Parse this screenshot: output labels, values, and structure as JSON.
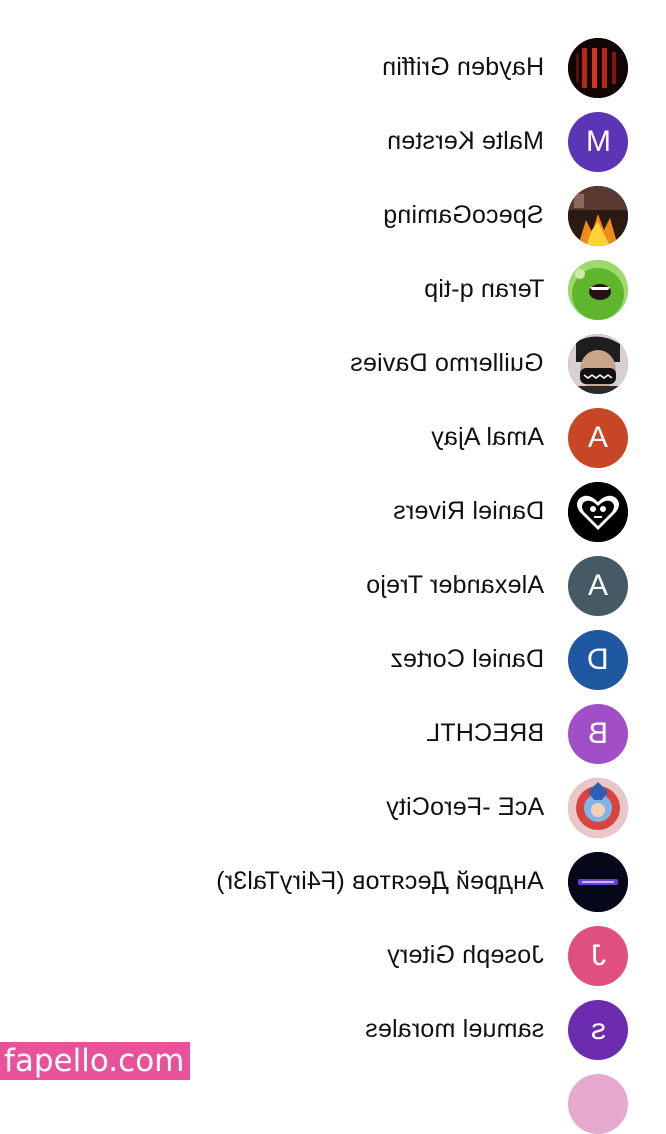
{
  "users": [
    {
      "name": "Hayden Griffin",
      "avatar_type": "image",
      "avatar_icon": "dark-red-game-art-avatar",
      "avatar_color": "#1a0a08"
    },
    {
      "name": "Malte Kersten",
      "avatar_type": "initial",
      "initial": "M",
      "avatar_color": "#5b35b5"
    },
    {
      "name": "SpecoGaming",
      "avatar_type": "image",
      "avatar_icon": "fire-scene-avatar",
      "avatar_color": "#3a1f14"
    },
    {
      "name": "Teran q-tip",
      "avatar_type": "image",
      "avatar_icon": "green-monster-avatar",
      "avatar_color": "#7bc43e"
    },
    {
      "name": "Guillermo Davies",
      "avatar_type": "image",
      "avatar_icon": "masked-person-avatar",
      "avatar_color": "#3c3c3c"
    },
    {
      "name": "Amal Ajay",
      "avatar_type": "initial",
      "initial": "A",
      "avatar_color": "#c64626"
    },
    {
      "name": "Daniel Rivers",
      "avatar_type": "image",
      "avatar_icon": "heart-skull-avatar",
      "avatar_color": "#000000"
    },
    {
      "name": "Alexander Trejo",
      "avatar_type": "initial",
      "initial": "A",
      "avatar_color": "#455a64"
    },
    {
      "name": "Daniel Cortez",
      "avatar_type": "initial",
      "initial": "D",
      "avatar_color": "#1f57a1"
    },
    {
      "name": "BRECHTL",
      "avatar_type": "initial",
      "initial": "B",
      "avatar_color": "#a14fc7"
    },
    {
      "name": "AcE -FeroCity",
      "avatar_type": "image",
      "avatar_icon": "anime-character-avatar",
      "avatar_color": "#d8433f"
    },
    {
      "name": "Андрей Десятов (F4iryTal3r)",
      "avatar_type": "image",
      "avatar_icon": "dark-logo-avatar",
      "avatar_color": "#0b0b1a"
    },
    {
      "name": "Joseph Gitery",
      "avatar_type": "initial",
      "initial": "J",
      "avatar_color": "#e0507f"
    },
    {
      "name": "samuel morales",
      "avatar_type": "initial",
      "initial": "s",
      "avatar_color": "#6d2bb0"
    }
  ],
  "watermark": "fapello.com"
}
